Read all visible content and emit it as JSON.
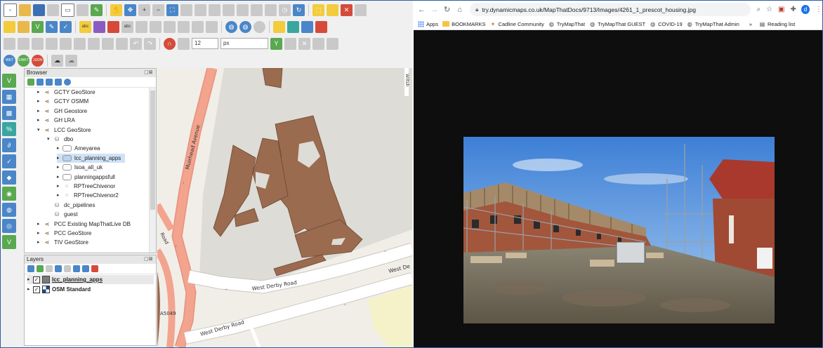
{
  "qgis": {
    "map_unit_value": "12",
    "map_unit_unit": "px",
    "browser_panel": {
      "title": "Browser",
      "items": [
        {
          "label": "GCTY GeoStore",
          "level": 1,
          "type": "db"
        },
        {
          "label": "GCTY OSMM",
          "level": 1,
          "type": "db"
        },
        {
          "label": "GH Geostore",
          "level": 1,
          "type": "db"
        },
        {
          "label": "GH LRA",
          "level": 1,
          "type": "db"
        },
        {
          "label": "LCC GeoStore",
          "level": 1,
          "type": "db",
          "expanded": true
        },
        {
          "label": "dbo",
          "level": 2,
          "type": "schema",
          "expanded": true
        },
        {
          "label": "Ameyarea",
          "level": 3,
          "type": "polygon"
        },
        {
          "label": "lcc_planning_apps",
          "level": 3,
          "type": "polygon",
          "selected": true
        },
        {
          "label": "lsoa_all_uk",
          "level": 3,
          "type": "polygon"
        },
        {
          "label": "planningappsfull",
          "level": 3,
          "type": "polygon"
        },
        {
          "label": "RPTreeChivenor",
          "level": 3,
          "type": "point"
        },
        {
          "label": "RPTreeChivenor2",
          "level": 3,
          "type": "point"
        },
        {
          "label": "dc_pipelines",
          "level": 2,
          "type": "table"
        },
        {
          "label": "guest",
          "level": 2,
          "type": "table"
        },
        {
          "label": "PCC Existing MapThatLive DB",
          "level": 1,
          "type": "db"
        },
        {
          "label": "PCC GeoStore",
          "level": 1,
          "type": "db"
        },
        {
          "label": "TIV GeoStore",
          "level": 1,
          "type": "db"
        }
      ]
    },
    "layers_panel": {
      "title": "Layers",
      "layers": [
        {
          "label": "lcc_planning_apps",
          "checked": true,
          "color": "#7b7b7b"
        },
        {
          "label": "OSM Standard",
          "checked": true
        }
      ]
    },
    "map": {
      "labels": {
        "murhead": "Muirhead Avenue",
        "west_derby_1": "West Derby Road",
        "west_derby_2": "West Derby Road",
        "west_dei": "West De",
        "road": "Road",
        "a5049": "A5049",
        "wiltsh": "Wiltsh"
      },
      "colors": {
        "building": "#9b6b4f",
        "main_road": "#f2a48f",
        "background": "#f1eee8"
      }
    }
  },
  "browser": {
    "url": "try.dynamicmaps.co.uk/MapThatDocs/9713/Images/4261_1_prescot_housing.jpg",
    "avatar_letter": "d",
    "bookmarks": [
      {
        "label": "Apps",
        "icon": "apps-icon"
      },
      {
        "label": "BOOKMARKS",
        "icon": "folder-icon"
      },
      {
        "label": "Cadline Community",
        "icon": "site-icon"
      },
      {
        "label": "TryMapThat",
        "icon": "globe-icon"
      },
      {
        "label": "TryMapThat GUEST",
        "icon": "globe-icon"
      },
      {
        "label": "COVID-19",
        "icon": "globe-icon"
      },
      {
        "label": "TryMapThat Admin",
        "icon": "globe-icon"
      }
    ],
    "more": "»",
    "reading_list": "Reading list"
  }
}
